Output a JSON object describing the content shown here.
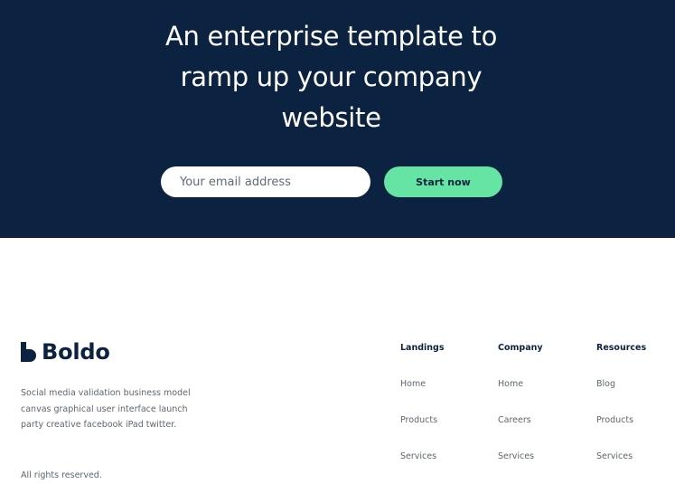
{
  "hero": {
    "title_lines": [
      "An enterprise template to",
      "ramp up your company",
      "website"
    ],
    "email_placeholder": "Your email address",
    "cta_label": "Start now"
  },
  "footer": {
    "brand_name": "Boldo",
    "description": "Social media validation business model canvas graphical user interface launch party creative facebook iPad twitter.",
    "copyright": "All rights reserved.",
    "columns": [
      {
        "heading": "Landings",
        "links": [
          "Home",
          "Products",
          "Services"
        ]
      },
      {
        "heading": "Company",
        "links": [
          "Home",
          "Careers",
          "Services"
        ]
      },
      {
        "heading": "Resources",
        "links": [
          "Blog",
          "Products",
          "Services"
        ]
      }
    ]
  },
  "colors": {
    "navy": "#0b2341",
    "accent_green": "#65e4a3",
    "muted_text": "#5c6670"
  },
  "icons": [
    "boldo-logo-icon"
  ]
}
